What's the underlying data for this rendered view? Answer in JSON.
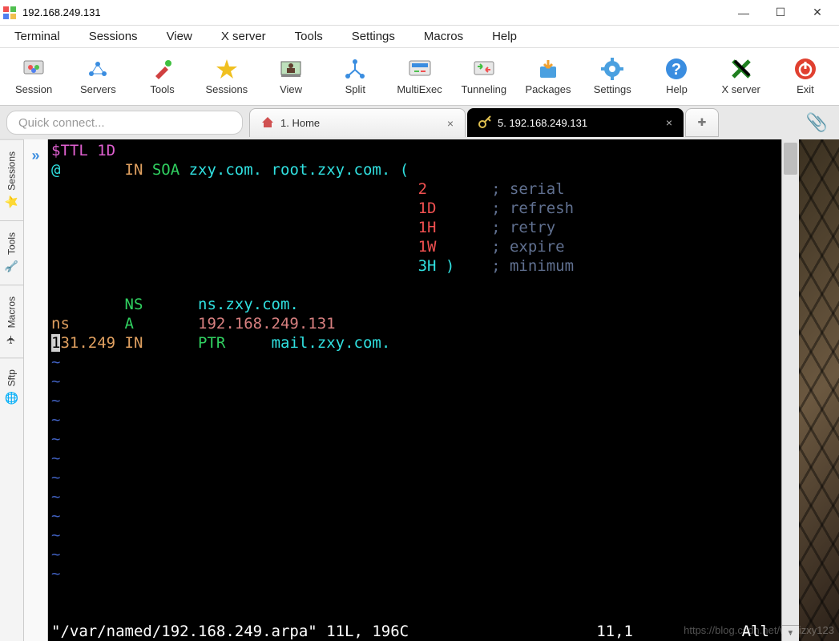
{
  "titlebar": {
    "ip": "192.168.249.131"
  },
  "menu": [
    "Terminal",
    "Sessions",
    "View",
    "X server",
    "Tools",
    "Settings",
    "Macros",
    "Help"
  ],
  "toolbar": [
    {
      "label": "Session",
      "color": "multi"
    },
    {
      "label": "Servers",
      "color": "blue"
    },
    {
      "label": "Tools",
      "color": "red"
    },
    {
      "label": "Sessions",
      "color": "star"
    },
    {
      "label": "View",
      "color": "green"
    },
    {
      "label": "Split",
      "color": "yblue"
    },
    {
      "label": "MultiExec",
      "color": "lb"
    },
    {
      "label": "Tunneling",
      "color": "gr"
    },
    {
      "label": "Packages",
      "color": "lb2"
    },
    {
      "label": "Settings",
      "color": "gear"
    },
    {
      "label": "Help",
      "color": "qb"
    },
    {
      "label": "X server",
      "color": "x"
    },
    {
      "label": "Exit",
      "color": "pw"
    }
  ],
  "quick_connect_placeholder": "Quick connect...",
  "tabs": {
    "home": "1. Home",
    "active": "5. 192.168.249.131",
    "add": "+"
  },
  "side_tabs": [
    "Sessions",
    "Tools",
    "Macros",
    "Sftp"
  ],
  "terminal": {
    "l1a": "$TTL 1D",
    "l2a": "@       ",
    "l2b": "IN ",
    "l2c": "SOA ",
    "l2d": "zxy.com. root.zxy.com. (",
    "p1v": "2",
    "p1c": "; serial",
    "p2v": "1D",
    "p2c": "; refresh",
    "p3v": "1H",
    "p3c": "; retry",
    "p4v": "1W",
    "p4c": "; expire",
    "p5v": "3H )",
    "p5c": "; minimum",
    "nsA": "        NS      ",
    "nsB": "ns.zxy.com.",
    "aA": "ns      ",
    "aB": "A       ",
    "aC": "192.168.249.131",
    "ptr_cursor": "1",
    "ptrA": "31.249 ",
    "ptrB": "IN      ",
    "ptrC": "PTR     ",
    "ptrD": "mail.zxy.com.",
    "tilde": "~",
    "status_file": "\"/var/named/192.168.249.arpa\" 11L, 196C",
    "status_pos": "11,1",
    "status_all": "All"
  },
  "watermark": "https://blog.csdn.net/woaizxy123"
}
